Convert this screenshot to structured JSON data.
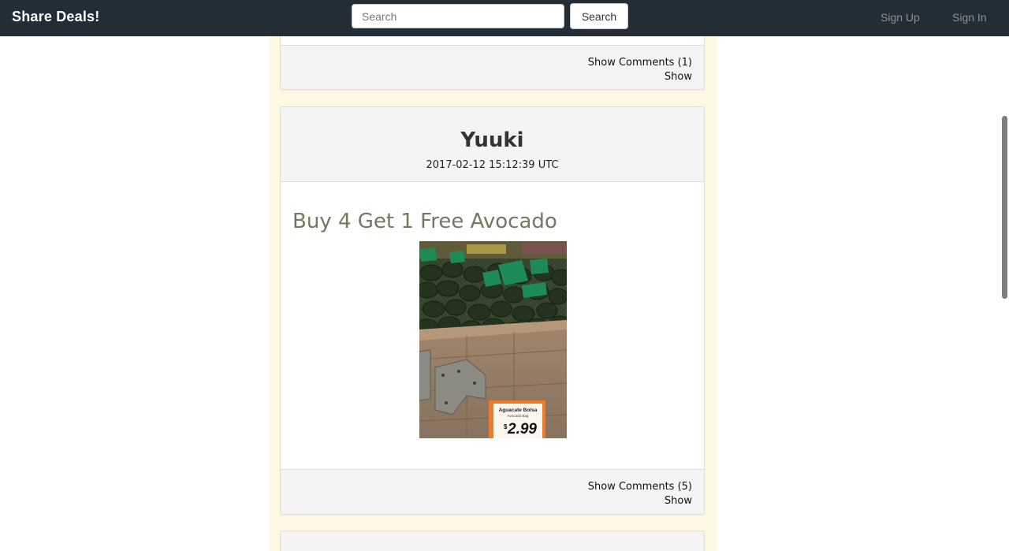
{
  "navbar": {
    "brand": "Share Deals!",
    "search_placeholder": "Search",
    "search_button": "Search",
    "sign_up": "Sign Up",
    "sign_in": "Sign In"
  },
  "posts": [
    {
      "show_comments": "Show Comments (1)",
      "show": "Show"
    },
    {
      "author": "Yuuki",
      "timestamp": "2017-02-12 15:12:39 UTC",
      "title": "Buy 4 Get 1 Free Avocado",
      "image": {
        "icon": "avocado-photo",
        "price_sign_title": "Aguacate Bolsa",
        "price_sign_subtitle": "Avocado Bag",
        "price": "2.99",
        "currency_symbol": "$"
      },
      "show_comments": "Show Comments (5)",
      "show": "Show"
    }
  ],
  "colors": {
    "navbar": "#222d36",
    "feed_background": "#fff8e4",
    "title": "#7a7561",
    "card_header": "#f4f4f4"
  }
}
